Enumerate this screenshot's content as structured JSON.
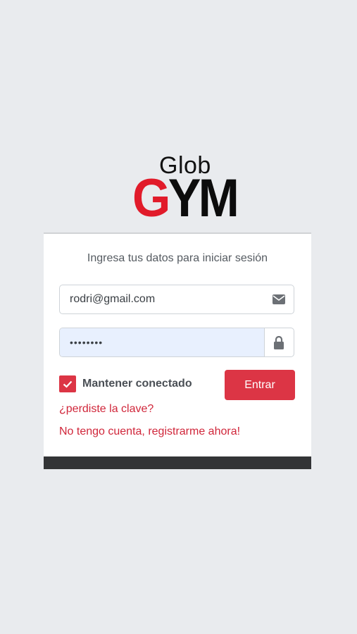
{
  "logo": {
    "top_text": "Glob",
    "main_letter": "G",
    "main_rest": "YM"
  },
  "login": {
    "subtitle": "Ingresa tus datos para iniciar sesión",
    "email_value": "rodri@gmail.com",
    "password_value": "••••••••",
    "remember_label": "Mantener conectado",
    "remember_checked": true,
    "submit_label": "Entrar",
    "forgot_link": "¿perdiste la clave?",
    "register_link": "No tengo cuenta, registrarme ahora!"
  },
  "icons": {
    "email_addon": "envelope-icon",
    "password_addon": "lock-icon",
    "checkbox_mark": "checkmark-icon"
  },
  "colors": {
    "accent": "#dc3545",
    "link": "#d0263a",
    "background": "#e9ebee",
    "footer_bar": "#333436",
    "autofill": "#e8f0fe"
  }
}
